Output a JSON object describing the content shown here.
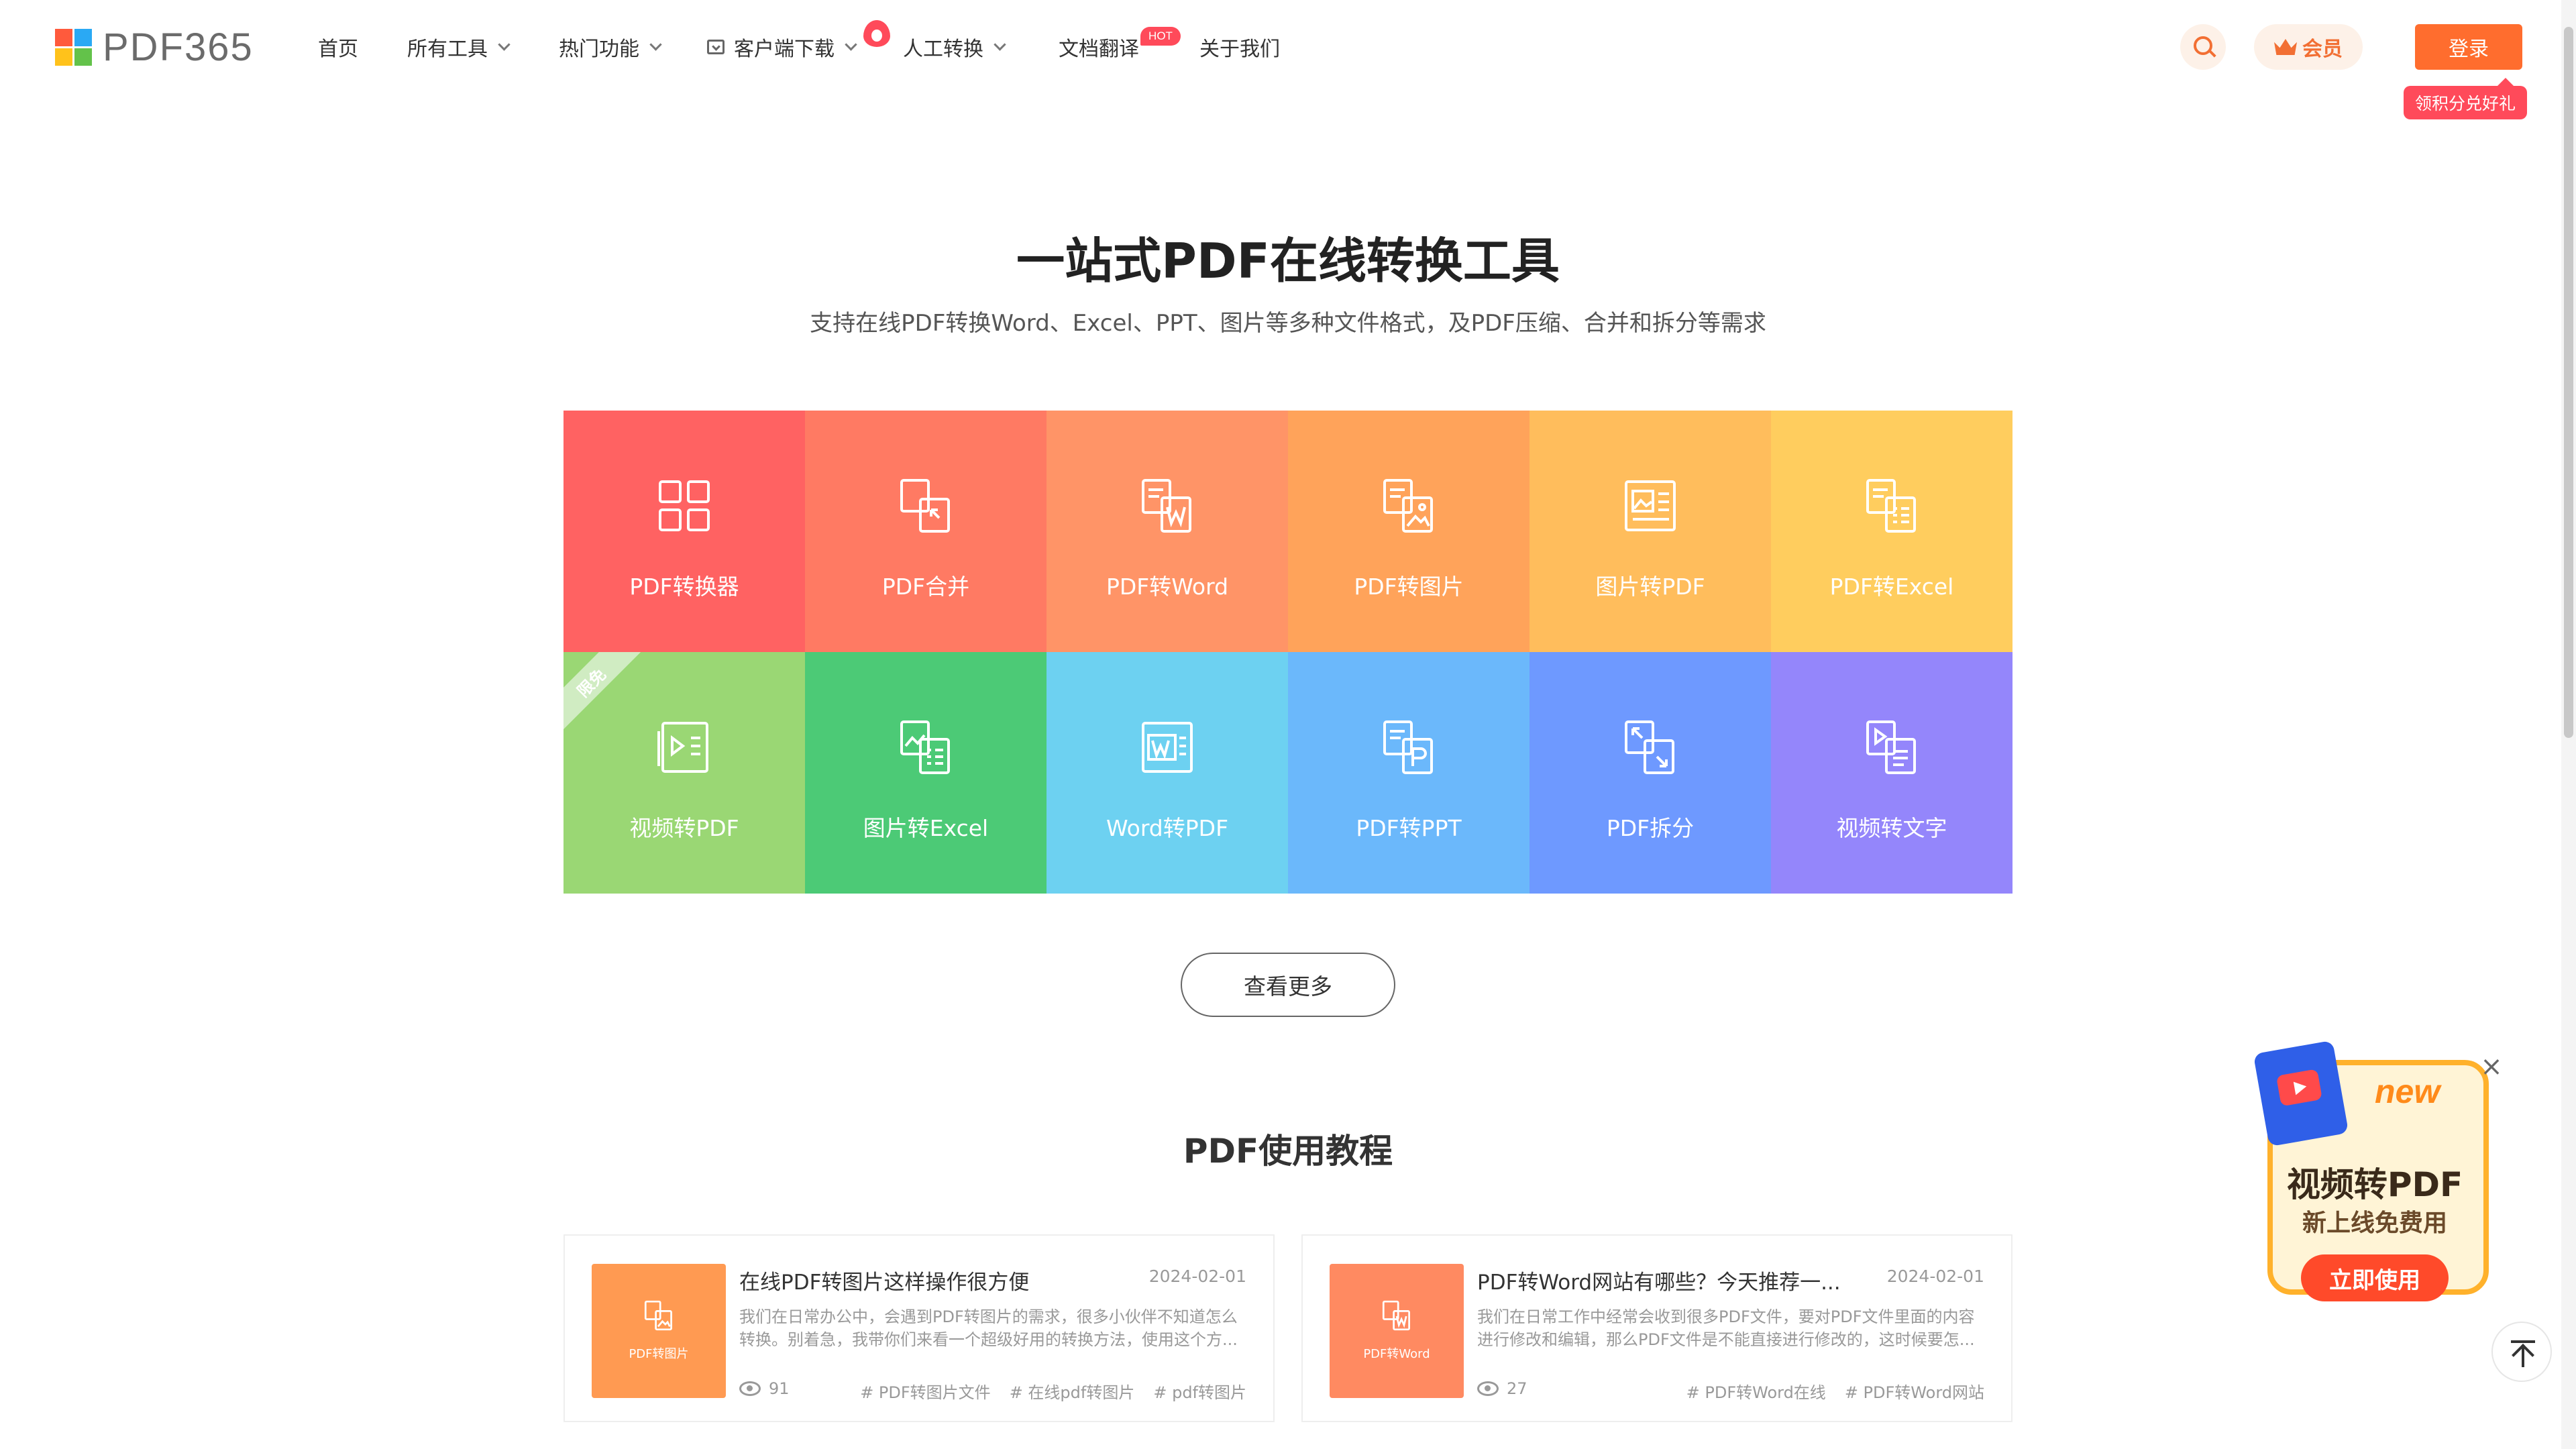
{
  "header": {
    "logo_text": "PDF365",
    "nav": [
      {
        "label": "首页"
      },
      {
        "label": "所有工具"
      },
      {
        "label": "热门功能"
      },
      {
        "label": "客户端下载"
      },
      {
        "label": "人工转换"
      },
      {
        "label": "文档翻译"
      },
      {
        "label": "关于我们"
      }
    ],
    "hot_badge": "HOT",
    "vip_label": "会员",
    "login_label": "登录",
    "reward_tip": "领积分兑好礼"
  },
  "hero": {
    "title": "一站式PDF在线转换工具",
    "subtitle": "支持在线PDF转换Word、Excel、PPT、图片等多种文件格式，及PDF压缩、合并和拆分等需求"
  },
  "tools": [
    {
      "label": "PDF转换器",
      "color": "#ff6262",
      "icon": "grid-icon"
    },
    {
      "label": "PDF合并",
      "color": "#ff7a63",
      "icon": "merge-icon"
    },
    {
      "label": "PDF转Word",
      "color": "#ff9467",
      "icon": "pdf-to-word-icon"
    },
    {
      "label": "PDF转图片",
      "color": "#ffa35a",
      "icon": "pdf-to-image-icon"
    },
    {
      "label": "图片转PDF",
      "color": "#ffbd5c",
      "icon": "image-to-pdf-icon"
    },
    {
      "label": "PDF转Excel",
      "color": "#ffcd5e",
      "icon": "pdf-to-excel-icon"
    },
    {
      "label": "视频转PDF",
      "color": "#9ad774",
      "icon": "video-to-pdf-icon",
      "ribbon": "限免"
    },
    {
      "label": "图片转Excel",
      "color": "#4cca76",
      "icon": "image-to-excel-icon"
    },
    {
      "label": "Word转PDF",
      "color": "#6dd1f1",
      "icon": "word-to-pdf-icon"
    },
    {
      "label": "PDF转PPT",
      "color": "#6bb8fb",
      "icon": "pdf-to-ppt-icon"
    },
    {
      "label": "PDF拆分",
      "color": "#6e99ff",
      "icon": "split-icon"
    },
    {
      "label": "视频转文字",
      "color": "#9486fb",
      "icon": "video-to-text-icon"
    }
  ],
  "more_label": "查看更多",
  "tutorial_title": "PDF使用教程",
  "articles": [
    {
      "title": "在线PDF转图片这样操作很方便",
      "date": "2024-02-01",
      "desc": "我们在日常办公中，会遇到PDF转图片的需求，很多小伙伴不知道怎么转换。别着急，我带你们来看一个超级好用的转换方法，使用这个方...",
      "views": "91",
      "thumb_label": "PDF转图片",
      "thumb_color": "#ff9a52",
      "tags": [
        "# PDF转图片文件",
        "# 在线pdf转图片",
        "# pdf转图片"
      ]
    },
    {
      "title": "PDF转Word网站有哪些？今天推荐一...",
      "date": "2024-02-01",
      "desc": "我们在日常工作中经常会收到很多PDF文件，要对PDF文件里面的内容进行修改和编辑，那么PDF文件是不能直接进行修改的，这时候要怎...",
      "views": "27",
      "thumb_label": "PDF转Word",
      "thumb_color": "#ff8a61",
      "tags": [
        "# PDF转Word在线",
        "# PDF转Word网站"
      ]
    }
  ],
  "promo": {
    "badge": "new",
    "title": "视频转PDF",
    "subtitle": "新上线免费用",
    "button": "立即使用"
  }
}
